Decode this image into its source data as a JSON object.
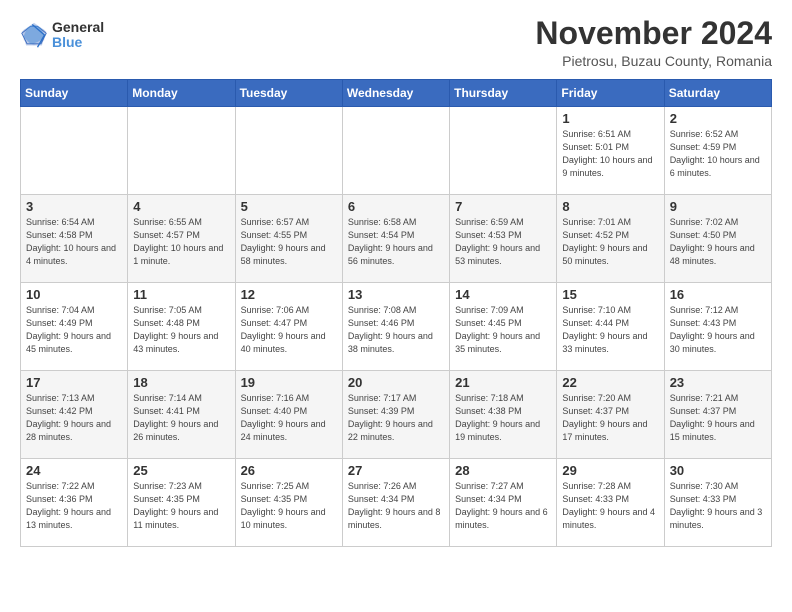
{
  "logo": {
    "general": "General",
    "blue": "Blue"
  },
  "title": "November 2024",
  "location": "Pietrosu, Buzau County, Romania",
  "days_of_week": [
    "Sunday",
    "Monday",
    "Tuesday",
    "Wednesday",
    "Thursday",
    "Friday",
    "Saturday"
  ],
  "weeks": [
    [
      {
        "day": "",
        "info": ""
      },
      {
        "day": "",
        "info": ""
      },
      {
        "day": "",
        "info": ""
      },
      {
        "day": "",
        "info": ""
      },
      {
        "day": "",
        "info": ""
      },
      {
        "day": "1",
        "info": "Sunrise: 6:51 AM\nSunset: 5:01 PM\nDaylight: 10 hours and 9 minutes."
      },
      {
        "day": "2",
        "info": "Sunrise: 6:52 AM\nSunset: 4:59 PM\nDaylight: 10 hours and 6 minutes."
      }
    ],
    [
      {
        "day": "3",
        "info": "Sunrise: 6:54 AM\nSunset: 4:58 PM\nDaylight: 10 hours and 4 minutes."
      },
      {
        "day": "4",
        "info": "Sunrise: 6:55 AM\nSunset: 4:57 PM\nDaylight: 10 hours and 1 minute."
      },
      {
        "day": "5",
        "info": "Sunrise: 6:57 AM\nSunset: 4:55 PM\nDaylight: 9 hours and 58 minutes."
      },
      {
        "day": "6",
        "info": "Sunrise: 6:58 AM\nSunset: 4:54 PM\nDaylight: 9 hours and 56 minutes."
      },
      {
        "day": "7",
        "info": "Sunrise: 6:59 AM\nSunset: 4:53 PM\nDaylight: 9 hours and 53 minutes."
      },
      {
        "day": "8",
        "info": "Sunrise: 7:01 AM\nSunset: 4:52 PM\nDaylight: 9 hours and 50 minutes."
      },
      {
        "day": "9",
        "info": "Sunrise: 7:02 AM\nSunset: 4:50 PM\nDaylight: 9 hours and 48 minutes."
      }
    ],
    [
      {
        "day": "10",
        "info": "Sunrise: 7:04 AM\nSunset: 4:49 PM\nDaylight: 9 hours and 45 minutes."
      },
      {
        "day": "11",
        "info": "Sunrise: 7:05 AM\nSunset: 4:48 PM\nDaylight: 9 hours and 43 minutes."
      },
      {
        "day": "12",
        "info": "Sunrise: 7:06 AM\nSunset: 4:47 PM\nDaylight: 9 hours and 40 minutes."
      },
      {
        "day": "13",
        "info": "Sunrise: 7:08 AM\nSunset: 4:46 PM\nDaylight: 9 hours and 38 minutes."
      },
      {
        "day": "14",
        "info": "Sunrise: 7:09 AM\nSunset: 4:45 PM\nDaylight: 9 hours and 35 minutes."
      },
      {
        "day": "15",
        "info": "Sunrise: 7:10 AM\nSunset: 4:44 PM\nDaylight: 9 hours and 33 minutes."
      },
      {
        "day": "16",
        "info": "Sunrise: 7:12 AM\nSunset: 4:43 PM\nDaylight: 9 hours and 30 minutes."
      }
    ],
    [
      {
        "day": "17",
        "info": "Sunrise: 7:13 AM\nSunset: 4:42 PM\nDaylight: 9 hours and 28 minutes."
      },
      {
        "day": "18",
        "info": "Sunrise: 7:14 AM\nSunset: 4:41 PM\nDaylight: 9 hours and 26 minutes."
      },
      {
        "day": "19",
        "info": "Sunrise: 7:16 AM\nSunset: 4:40 PM\nDaylight: 9 hours and 24 minutes."
      },
      {
        "day": "20",
        "info": "Sunrise: 7:17 AM\nSunset: 4:39 PM\nDaylight: 9 hours and 22 minutes."
      },
      {
        "day": "21",
        "info": "Sunrise: 7:18 AM\nSunset: 4:38 PM\nDaylight: 9 hours and 19 minutes."
      },
      {
        "day": "22",
        "info": "Sunrise: 7:20 AM\nSunset: 4:37 PM\nDaylight: 9 hours and 17 minutes."
      },
      {
        "day": "23",
        "info": "Sunrise: 7:21 AM\nSunset: 4:37 PM\nDaylight: 9 hours and 15 minutes."
      }
    ],
    [
      {
        "day": "24",
        "info": "Sunrise: 7:22 AM\nSunset: 4:36 PM\nDaylight: 9 hours and 13 minutes."
      },
      {
        "day": "25",
        "info": "Sunrise: 7:23 AM\nSunset: 4:35 PM\nDaylight: 9 hours and 11 minutes."
      },
      {
        "day": "26",
        "info": "Sunrise: 7:25 AM\nSunset: 4:35 PM\nDaylight: 9 hours and 10 minutes."
      },
      {
        "day": "27",
        "info": "Sunrise: 7:26 AM\nSunset: 4:34 PM\nDaylight: 9 hours and 8 minutes."
      },
      {
        "day": "28",
        "info": "Sunrise: 7:27 AM\nSunset: 4:34 PM\nDaylight: 9 hours and 6 minutes."
      },
      {
        "day": "29",
        "info": "Sunrise: 7:28 AM\nSunset: 4:33 PM\nDaylight: 9 hours and 4 minutes."
      },
      {
        "day": "30",
        "info": "Sunrise: 7:30 AM\nSunset: 4:33 PM\nDaylight: 9 hours and 3 minutes."
      }
    ]
  ]
}
